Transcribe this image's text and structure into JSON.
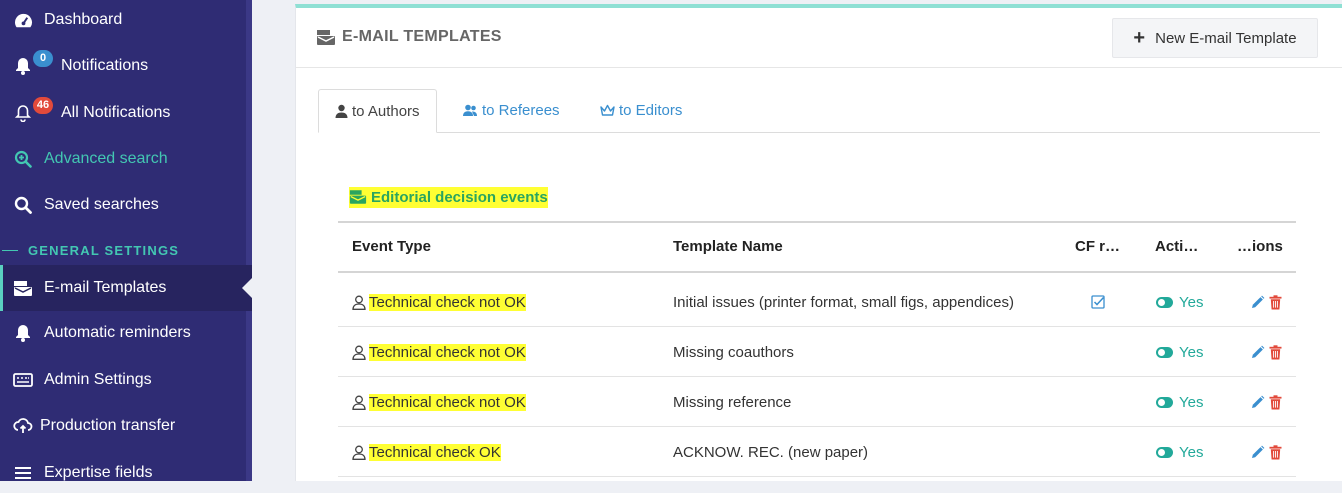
{
  "sidebar": {
    "items": [
      {
        "label": "Dashboard",
        "icon": "dashboard-icon"
      },
      {
        "label": "Notifications",
        "icon": "bell-icon",
        "badge": "0",
        "badge_color": "#3a8fcf"
      },
      {
        "label": "All Notifications",
        "icon": "bell-outline-icon",
        "badge": "46",
        "badge_color": "#e24a3b"
      },
      {
        "label": "Advanced search",
        "icon": "search-plus-icon"
      },
      {
        "label": "Saved searches",
        "icon": "search-icon"
      },
      {
        "label": "E-mail Templates",
        "icon": "mail-stack-icon"
      },
      {
        "label": "Automatic reminders",
        "icon": "bell-icon"
      },
      {
        "label": "Admin Settings",
        "icon": "keyboard-icon"
      },
      {
        "label": "Production transfer",
        "icon": "cloud-upload-icon"
      },
      {
        "label": "Expertise fields",
        "icon": "list-icon"
      }
    ],
    "section_label": "GENERAL SETTINGS"
  },
  "card": {
    "title": "E-MAIL TEMPLATES",
    "new_button": "New E-mail Template",
    "accent_color": "#8fe0d4"
  },
  "tabs": [
    {
      "label": "to Authors",
      "icon": "user-icon"
    },
    {
      "label": "to Referees",
      "icon": "users-icon"
    },
    {
      "label": "to Editors",
      "icon": "crown-icon"
    }
  ],
  "section_heading": "Editorial decision events",
  "table": {
    "columns": [
      "Event Type",
      "Template Name",
      "CF r…",
      "Acti…",
      "…ions"
    ],
    "rows": [
      {
        "event_type": "Technical check not OK",
        "template_name": "Initial issues (printer format, small figs, appendices)",
        "cf": true,
        "active": "Yes"
      },
      {
        "event_type": "Technical check not OK",
        "template_name": "Missing coauthors",
        "cf": false,
        "active": "Yes"
      },
      {
        "event_type": "Technical check not OK",
        "template_name": "Missing reference",
        "cf": false,
        "active": "Yes"
      },
      {
        "event_type": "Technical check OK",
        "template_name": "ACKNOW. REC. (new paper)",
        "cf": false,
        "active": "Yes"
      }
    ]
  },
  "colors": {
    "sidebar_bg": "#2f2c74",
    "teal": "#22a99a",
    "link_blue": "#3a8fcf",
    "highlight": "#ffff33",
    "danger": "#e24a3b"
  }
}
